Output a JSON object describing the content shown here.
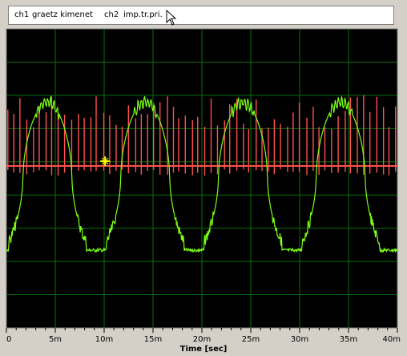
{
  "legend": {
    "ch1_id": "ch1",
    "ch1_name": "graetz kimenet",
    "ch2_id": "ch2",
    "ch2_name": "imp.tr.pri."
  },
  "x_axis": {
    "title": "Time [sec]",
    "ticks": [
      "0",
      "5m",
      "10m",
      "15m",
      "20m",
      "25m",
      "30m",
      "35m",
      "40m"
    ]
  },
  "colors": {
    "background": "#000000",
    "grid": "#0a6e0a",
    "ch1": "#7cff1a",
    "ch2": "#ff5050",
    "marker": "#ffff00"
  },
  "chart_data": {
    "type": "line",
    "x_range_ms": [
      0,
      40
    ],
    "grid": true,
    "series": [
      {
        "name": "graetz kimenet",
        "color": "#7cff1a",
        "waveform": "distorted periodic wave, period ~10 ms, high plateau with ripple, low flat trough",
        "period_ms": 10
      },
      {
        "name": "imp.tr.pri.",
        "color": "#ff5050",
        "waveform": "dense narrow spikes above and below a baseline",
        "spike_interval_ms": 0.65
      }
    ],
    "marker_icon": "crosshair-marker-icon"
  }
}
